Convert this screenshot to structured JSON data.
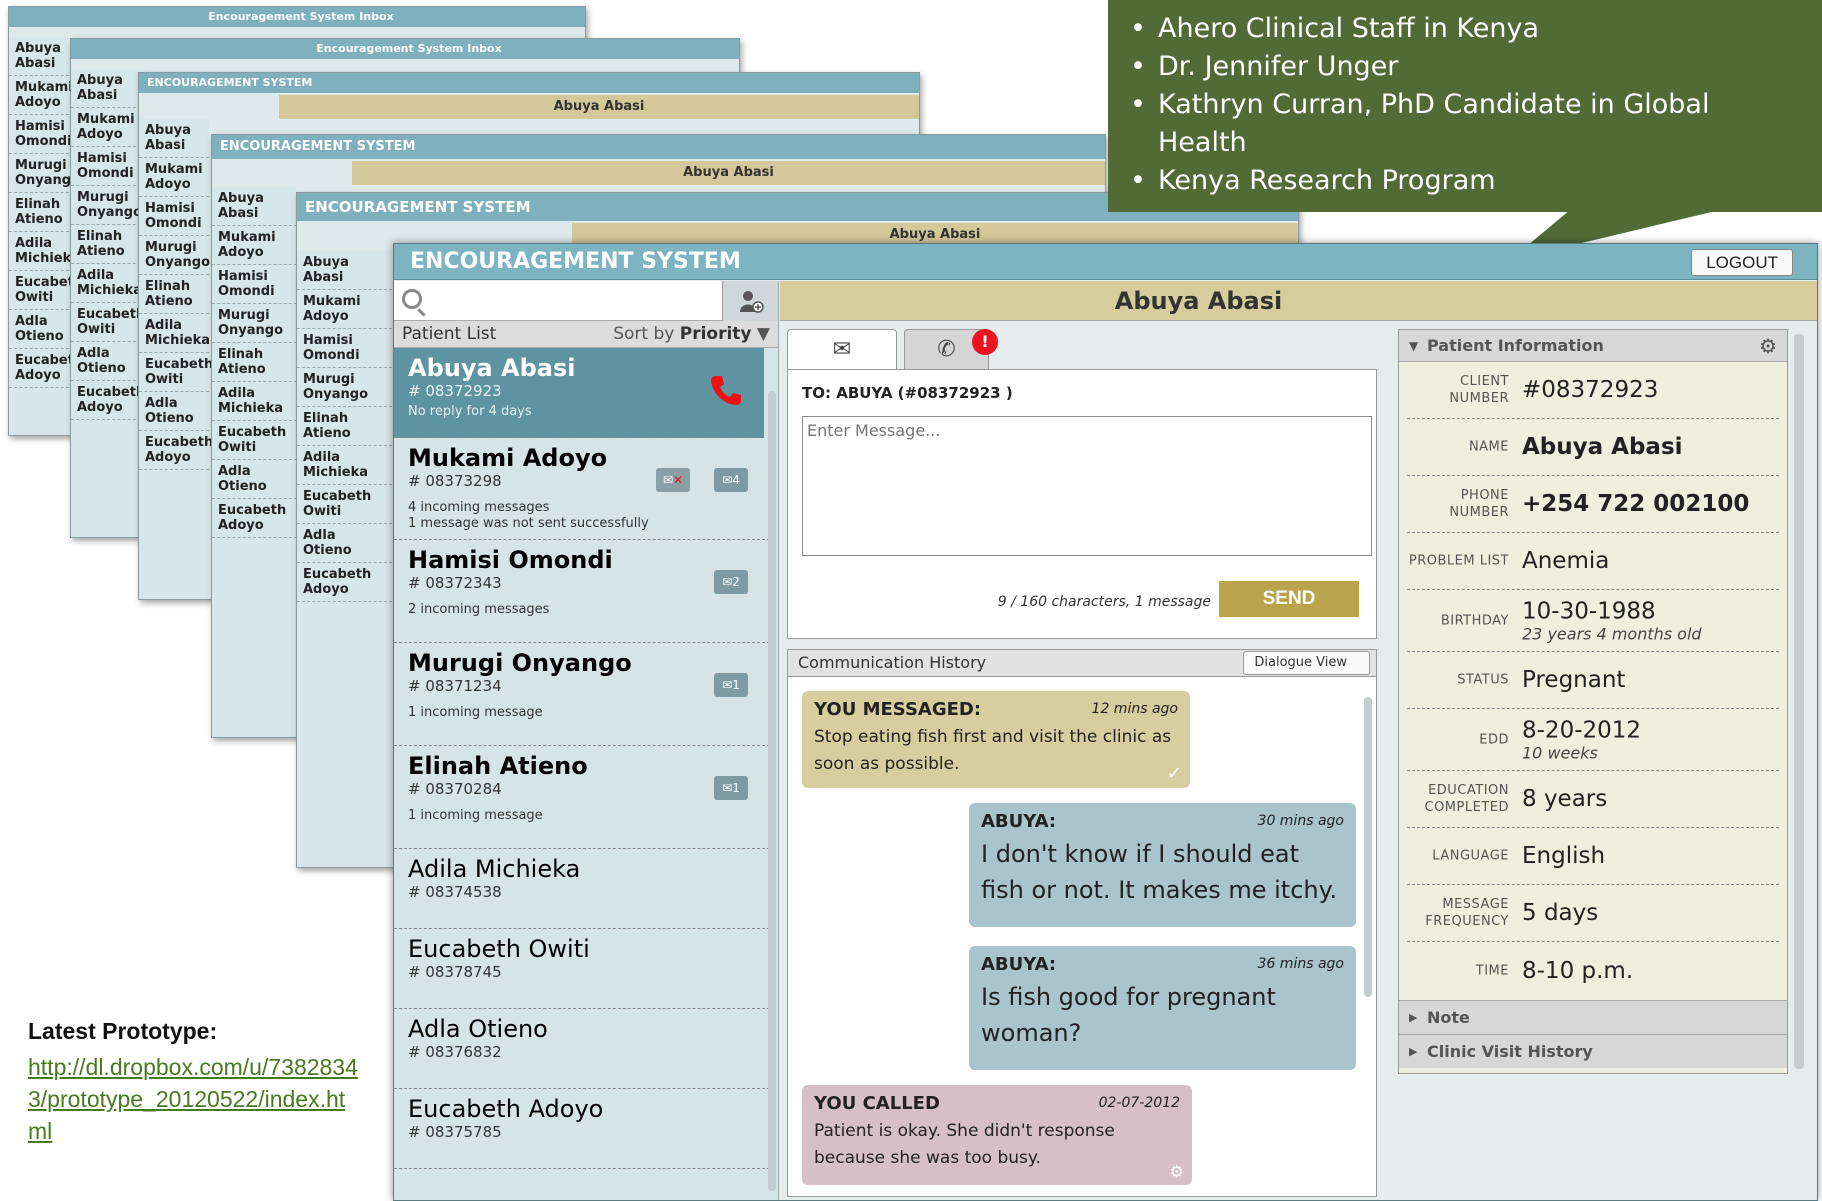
{
  "callout": {
    "items": [
      "Ahero Clinical Staff in Kenya",
      "Dr. Jennifer Unger",
      "Kathryn Curran, PhD Candidate in Global Health",
      "Kenya Research Program"
    ]
  },
  "bg": {
    "title_inbox": "Encouragement System Inbox",
    "title_sys": "ENCOURAGEMENT SYSTEM",
    "logout": "LOGOUT",
    "patient": "Abuya Abasi",
    "rows": [
      "Abuya Abasi",
      "Mukami Adoyo",
      "Hamisi Omondi",
      "Murugi Onyango",
      "Elinah Atieno",
      "Adila Michieka",
      "Eucabeth Owiti",
      "Adla Otieno",
      "Eucabeth Adoyo"
    ]
  },
  "app": {
    "title": "ENCOURAGEMENT SYSTEM",
    "logout": "LOGOUT",
    "patient_header": "Abuya Abasi"
  },
  "patient_list": {
    "heading": "Patient List",
    "sort_prefix": "Sort by",
    "sort_value": "Priority",
    "patients": [
      {
        "name": "Abuya Abasi",
        "id": "# 08372923",
        "note1": "No reply for 4 days",
        "note2": ""
      },
      {
        "name": "Mukami Adoyo",
        "id": "# 08373298",
        "note1": "4 incoming messages",
        "note2": "1 message was not sent successfully"
      },
      {
        "name": "Hamisi Omondi",
        "id": "# 08372343",
        "note1": "2 incoming messages",
        "note2": ""
      },
      {
        "name": "Murugi Onyango",
        "id": "# 08371234",
        "note1": "1 incoming message",
        "note2": ""
      },
      {
        "name": "Elinah Atieno",
        "id": "# 08370284",
        "note1": "1 incoming message",
        "note2": ""
      },
      {
        "name": "Adila Michieka",
        "id": "# 08374538",
        "note1": "",
        "note2": ""
      },
      {
        "name": "Eucabeth Owiti",
        "id": "# 08378745",
        "note1": "",
        "note2": ""
      },
      {
        "name": "Adla Otieno",
        "id": "# 08376832",
        "note1": "",
        "note2": ""
      },
      {
        "name": "Eucabeth Adoyo",
        "id": "# 08375785",
        "note1": "",
        "note2": ""
      }
    ],
    "badges": {
      "mukami": "4",
      "hamisi": "2",
      "murugi": "1",
      "elinah": "1"
    }
  },
  "compose": {
    "badge": "!",
    "to": "TO: ABUYA  (#08372923 )",
    "placeholder": "Enter Message...",
    "count": "9 / 160 characters, 1 message",
    "send": "SEND"
  },
  "history": {
    "heading": "Communication History",
    "view": "Dialogue View",
    "messages": [
      {
        "who": "YOU MESSAGED:",
        "ago": "12 mins ago",
        "text": "Stop eating fish first and visit the clinic as soon as possible."
      },
      {
        "who": "ABUYA:",
        "ago": "30 mins ago",
        "text": "I don't know if I should eat fish or not.  It makes me itchy."
      },
      {
        "who": "ABUYA:",
        "ago": "36 mins ago",
        "text": "Is fish good for pregnant woman?"
      },
      {
        "who": "YOU CALLED",
        "ago": "02-07-2012",
        "text": "Patient is okay.  She didn't response because she was too busy."
      }
    ]
  },
  "info": {
    "heading": "Patient Information",
    "fields": [
      {
        "label": "CLIENT NUMBER",
        "value": "#08372923",
        "sub": ""
      },
      {
        "label": "NAME",
        "value": "Abuya Abasi",
        "sub": ""
      },
      {
        "label": "PHONE NUMBER",
        "value": "+254 722 002100",
        "sub": ""
      },
      {
        "label": "PROBLEM LIST",
        "value": "Anemia",
        "sub": ""
      },
      {
        "label": "BIRTHDAY",
        "value": "10-30-1988",
        "sub": "23 years 4 months old"
      },
      {
        "label": "STATUS",
        "value": "Pregnant",
        "sub": ""
      },
      {
        "label": "EDD",
        "value": "8-20-2012",
        "sub": "10 weeks"
      },
      {
        "label": "EDUCATION COMPLETED",
        "value": "8 years",
        "sub": ""
      },
      {
        "label": "LANGUAGE",
        "value": "English",
        "sub": ""
      },
      {
        "label": "MESSAGE FREQUENCY",
        "value": "5 days",
        "sub": ""
      },
      {
        "label": "TIME",
        "value": "8-10 p.m.",
        "sub": ""
      }
    ],
    "note": "Note",
    "clinic": "Clinic Visit History"
  },
  "prototype": {
    "label": "Latest Prototype:",
    "url": "http://dl.dropbox.com/u/73828343/prototype_20120522/index.html"
  }
}
